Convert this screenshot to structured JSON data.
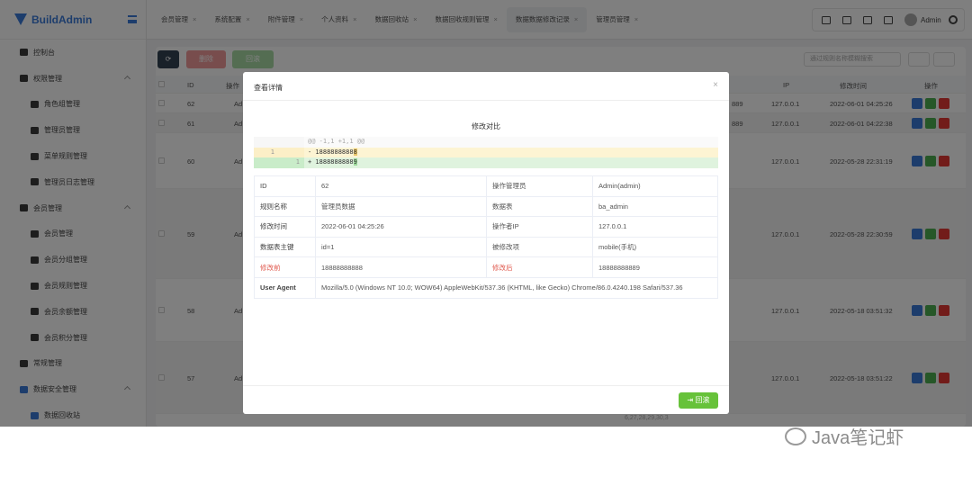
{
  "app": {
    "logo": "BuildAdmin",
    "menu": [
      {
        "type": "top",
        "label": "控制台"
      },
      {
        "type": "top",
        "label": "权限管理",
        "caret": true
      },
      {
        "type": "sub",
        "label": "角色组管理"
      },
      {
        "type": "sub",
        "label": "管理员管理"
      },
      {
        "type": "sub",
        "label": "菜单规则管理"
      },
      {
        "type": "sub",
        "label": "管理员日志管理"
      },
      {
        "type": "top",
        "label": "会员管理",
        "caret": true
      },
      {
        "type": "sub",
        "label": "会员管理"
      },
      {
        "type": "sub",
        "label": "会员分组管理"
      },
      {
        "type": "sub",
        "label": "会员规则管理"
      },
      {
        "type": "sub",
        "label": "会员余额管理"
      },
      {
        "type": "sub",
        "label": "会员积分管理"
      },
      {
        "type": "top",
        "label": "常规管理"
      },
      {
        "type": "top",
        "label": "数据安全管理",
        "caret": true,
        "blue": true
      },
      {
        "type": "sub",
        "label": "数据回收站",
        "blue": true
      }
    ],
    "tabs": [
      "会员管理",
      "系统配置",
      "附件管理",
      "个人资料",
      "数据回收站",
      "数据回收规则管理",
      "数据数据修改记录",
      "管理员管理"
    ],
    "active_tab": 6,
    "tab_close": "×",
    "user": "Admin"
  },
  "toolbar": {
    "refresh": "⟳",
    "delete": "删除",
    "rollback": "回滚",
    "search_placeholder": "通过规则名称模糊搜索"
  },
  "table": {
    "headers": {
      "id": "ID",
      "op": "操作",
      "ip": "IP",
      "time": "修改时间",
      "actions": "操作"
    },
    "rows": [
      {
        "id": "62",
        "admin": "Ad",
        "frag": "889",
        "ip": "127.0.0.1",
        "time": "2022-06-01 04:25:26"
      },
      {
        "id": "61",
        "admin": "Ad",
        "frag": "889",
        "ip": "127.0.0.1",
        "time": "2022-06-01 04:22:38"
      },
      {
        "id": "60",
        "admin": "Ad",
        "frag": "",
        "ip": "127.0.0.1",
        "time": "2022-05-28 22:31:19"
      },
      {
        "id": "59",
        "admin": "Ad",
        "frag": "",
        "ip": "127.0.0.1",
        "time": "2022-05-28 22:30:59"
      },
      {
        "id": "58",
        "admin": "Ad",
        "frag": "",
        "ip": "127.0.0.1",
        "time": "2022-05-18 03:51:32"
      },
      {
        "id": "57",
        "admin": "Ad",
        "frag": "",
        "ip": "127.0.0.1",
        "time": "2022-05-18 03:51:22"
      }
    ],
    "bottom_fragment": "6,27,28,29,30,3"
  },
  "modal": {
    "title": "查看详情",
    "close": "×",
    "diff_title": "修改对比",
    "diff": {
      "hunk": "@@ -1,1 +1,1 @@",
      "minus_ln": "1",
      "minus_prefix": "- 1888888888",
      "minus_tail": "8",
      "plus_ln": "1",
      "plus_prefix": "+ 1888888888",
      "plus_tail": "9"
    },
    "details": [
      {
        "l1": "ID",
        "v1": "62",
        "l2": "操作管理员",
        "v2": "Admin(admin)"
      },
      {
        "l1": "规则名称",
        "v1": "管理员数据",
        "l2": "数据表",
        "v2": "ba_admin"
      },
      {
        "l1": "修改时间",
        "v1": "2022-06-01 04:25:26",
        "l2": "操作者IP",
        "v2": "127.0.0.1"
      },
      {
        "l1": "数据表主键",
        "v1": "id=1",
        "l2": "被修改项",
        "v2": "mobile(手机)"
      },
      {
        "l1": "修改前",
        "v1": "18888888888",
        "l2": "修改后",
        "v2": "18888888889"
      }
    ],
    "user_agent_label": "User Agent",
    "user_agent": "Mozilla/5.0 (Windows NT 10.0; WOW64) AppleWebKit/537.36 (KHTML, like Gecko) Chrome/86.0.4240.198 Safari/537.36",
    "rollback_button": "回滚"
  },
  "watermark": "Java笔记虾",
  "colors": {
    "brand": "#3b7bd9",
    "success": "#67c23a",
    "danger": "#e53935",
    "diff_removed": "#fdf4d3",
    "diff_added": "#dff3de",
    "label_red": "#e05a4f"
  }
}
